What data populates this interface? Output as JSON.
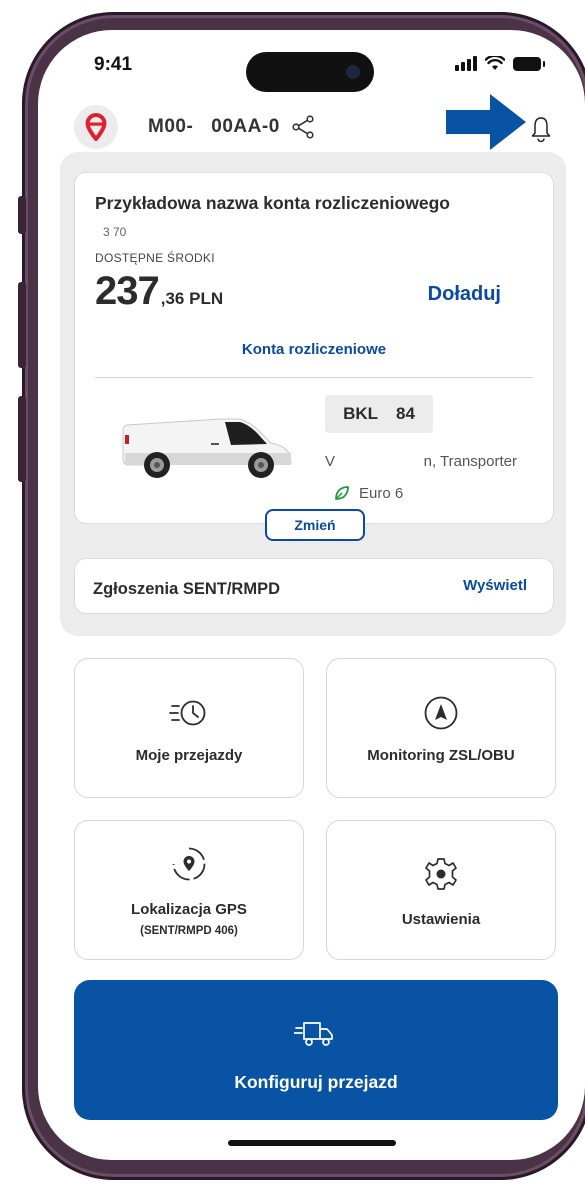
{
  "status_bar": {
    "time": "9:41"
  },
  "header": {
    "account_prefix": "M00-",
    "account_suffix": "00AA-0",
    "logo_icon": "location-pin-logo-icon",
    "notification_icon": "bell-icon"
  },
  "billing_card": {
    "account_name": "Przykładowa nazwa konta rozliczeniowego",
    "account_number": "3 70",
    "available_label": "DOSTĘPNE ŚRODKI",
    "balance_main": "237",
    "balance_sub": ",36 PLN",
    "topup_label": "Doładuj",
    "accounts_link": "Konta rozliczeniowe"
  },
  "vehicle": {
    "plate_part1": "BKL",
    "plate_part2": "84",
    "model_left": "V",
    "model_right": "n, Transporter",
    "emission": "Euro 6",
    "change_label": "Zmień"
  },
  "sent": {
    "label": "Zgłoszenia SENT/RMPD",
    "link": "Wyświetl"
  },
  "tiles": [
    {
      "label": "Moje przejazdy",
      "icon": "history-clock-icon"
    },
    {
      "label": "Monitoring ZSL/OBU",
      "icon": "navigation-compass-icon"
    },
    {
      "label": "Lokalizacja GPS",
      "sub": "(SENT/RMPD 406)",
      "icon": "gps-location-icon"
    },
    {
      "label": "Ustawienia",
      "icon": "settings-gear-icon"
    }
  ],
  "cta": {
    "label": "Konfiguruj przejazd",
    "icon": "fast-truck-icon"
  },
  "colors": {
    "brand_blue": "#0953a4",
    "link_blue": "#0a4aa0",
    "logo_red": "#e0202f",
    "panel_gray": "#ececec"
  }
}
